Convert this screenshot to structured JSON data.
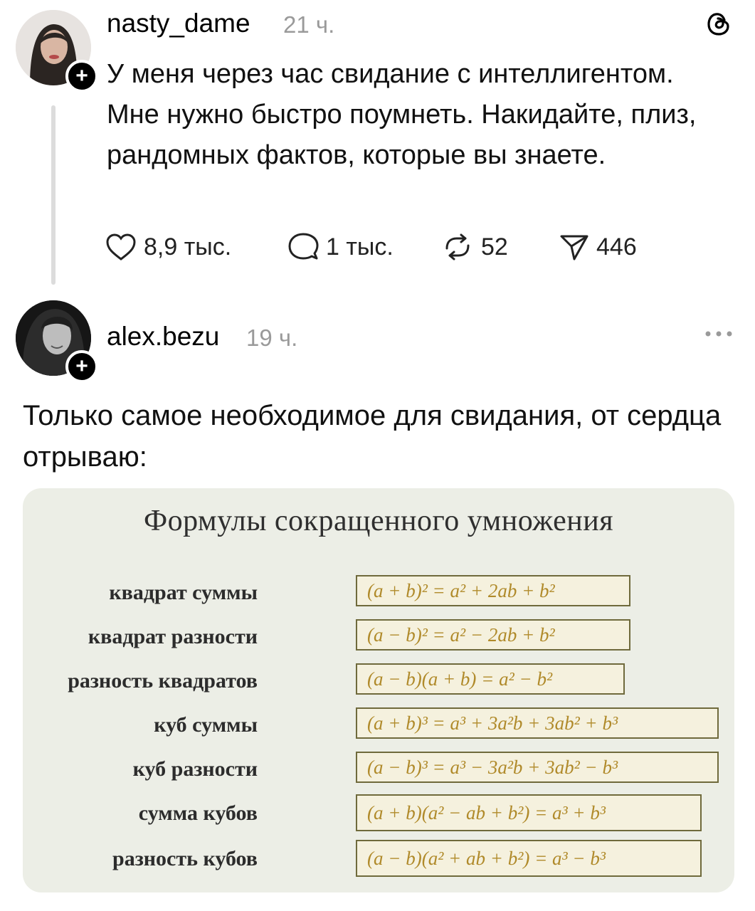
{
  "post": {
    "username": "nasty_dame",
    "time": "21 ч.",
    "text": "У меня через час свидание с интеллигентом. Мне нужно быстро поумнеть. Накидайте, плиз, рандомных фактов, которые вы знаете.",
    "likes": "8,9 тыс.",
    "comments": "1 тыс.",
    "reposts": "52",
    "shares": "446"
  },
  "reply": {
    "username": "alex.bezu",
    "time": "19 ч.",
    "text": "Только самое необходимое для свидания, от сердца отрываю:"
  },
  "formula_card": {
    "title": "Формулы сокращенного умножения",
    "rows": [
      {
        "label": "квадрат суммы",
        "formula": "(a + b)² = a² + 2ab + b²"
      },
      {
        "label": "квадрат разности",
        "formula": "(a − b)² = a² − 2ab + b²"
      },
      {
        "label": "разность квадратов",
        "formula": "(a − b)(a + b) = a² − b²"
      },
      {
        "label": "куб суммы",
        "formula": "(a + b)³ = a³ + 3a²b + 3ab² + b³"
      },
      {
        "label": "куб разности",
        "formula": "(a − b)³ = a³ − 3a²b + 3ab² − b³"
      },
      {
        "label": "сумма кубов",
        "formula": "(a + b)(a² − ab + b²) = a³ + b³"
      },
      {
        "label": "разность кубов",
        "formula": "(a − b)(a² + ab + b²) = a³ − b³"
      }
    ]
  },
  "colors": {
    "card_bg": "#eceee6",
    "formula_text": "#b08a2a",
    "muted": "#9a9a9a"
  }
}
